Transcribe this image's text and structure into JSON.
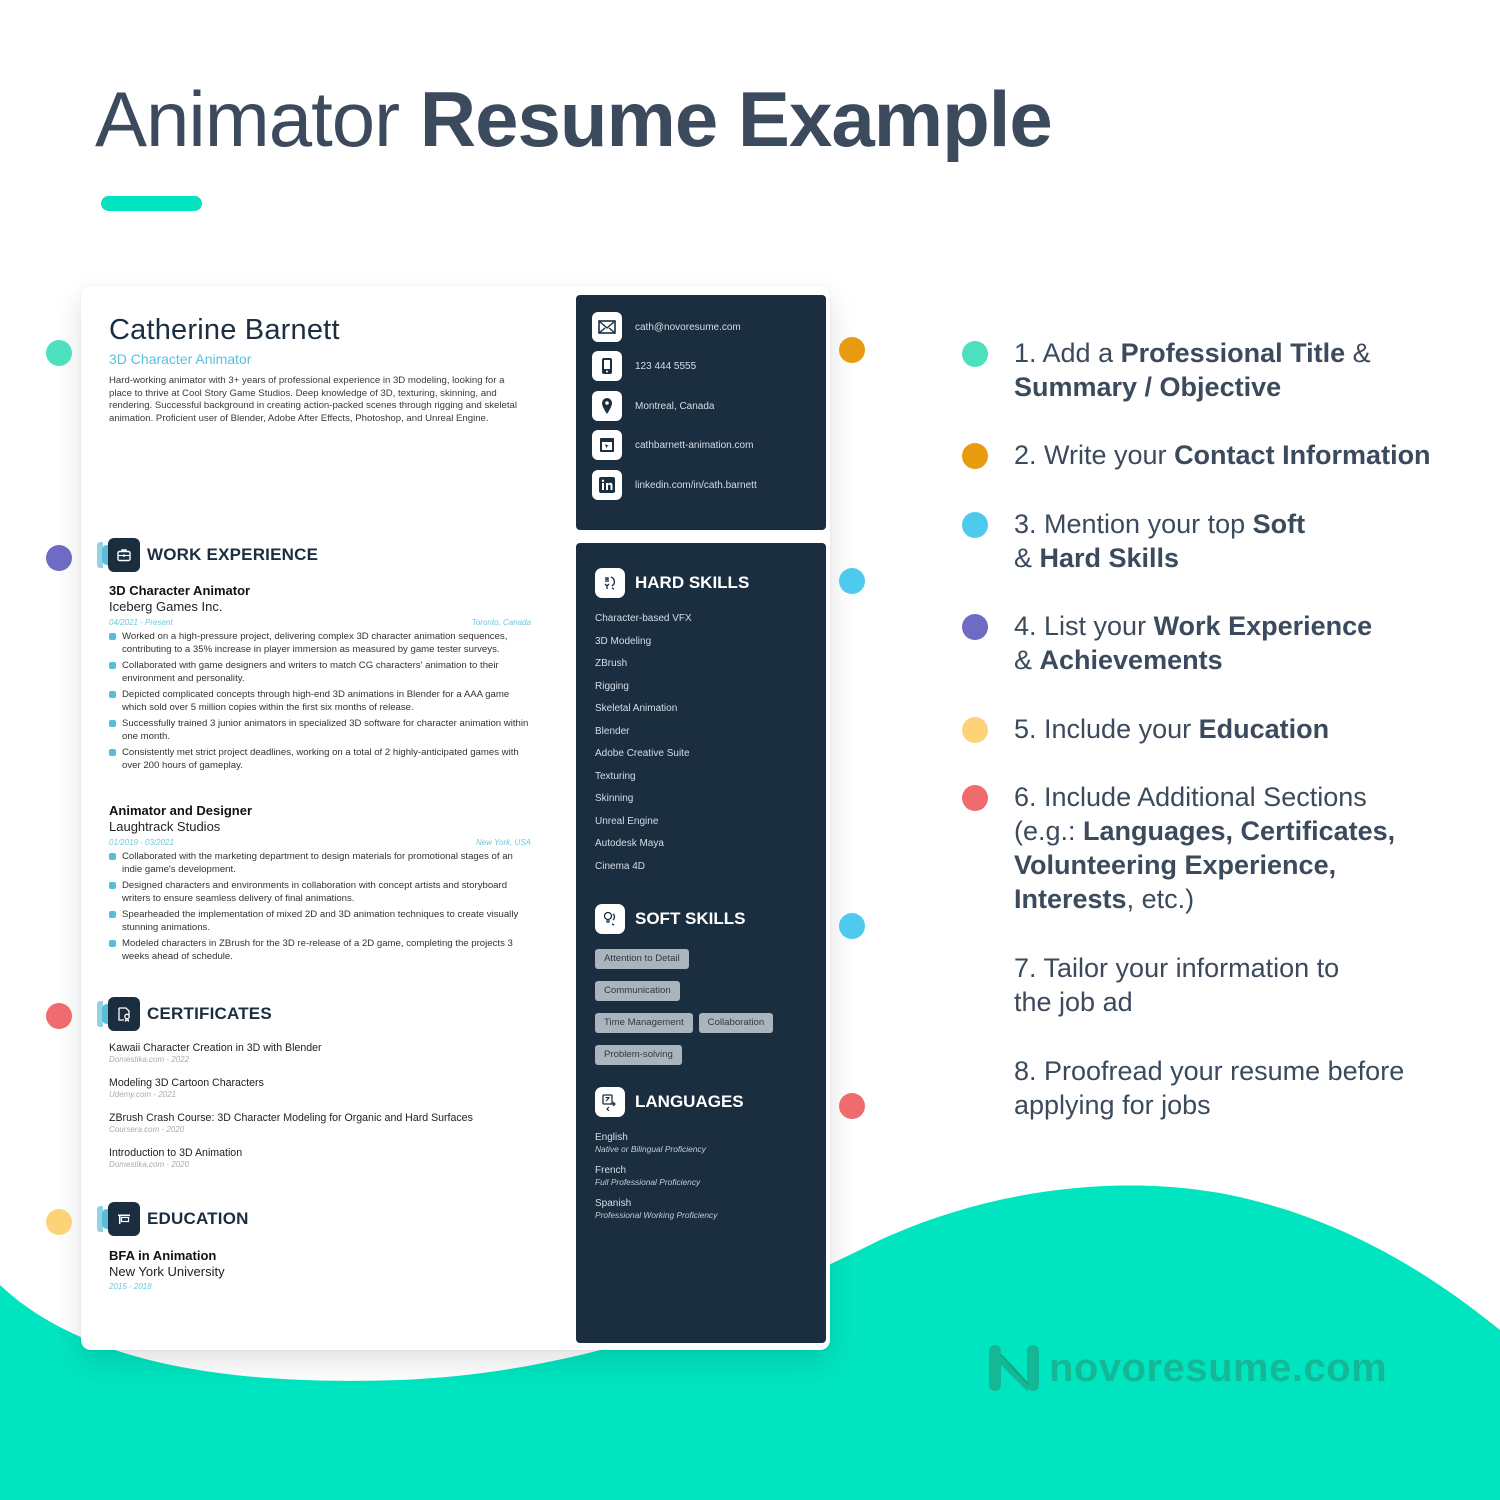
{
  "colors": {
    "accent": "#00e5c0",
    "navy": "#1b2e40",
    "skyblue": "#5bbcd6",
    "marker_teal": "#4de0bf",
    "marker_orange": "#e89b0f",
    "marker_cyan": "#4dcaee",
    "marker_purple": "#6e6bc5",
    "marker_yellow": "#fdd37a",
    "marker_red": "#ef6b6e"
  },
  "header": {
    "title_light": "Animator",
    "title_bold": "Resume Example"
  },
  "resume": {
    "name": "Catherine Barnett",
    "role": "3D Character Animator",
    "summary": "Hard-working animator with 3+ years of professional experience in 3D modeling, looking for a place to thrive at Cool Story Game Studios. Deep knowledge of 3D, texturing, skinning, and rendering. Successful background in creating action-packed scenes through rigging and skeletal animation. Proficient user of Blender, Adobe After Effects, Photoshop, and Unreal Engine.",
    "contact": [
      {
        "icon": "email-icon",
        "text": "cath@novoresume.com"
      },
      {
        "icon": "phone-icon",
        "text": "123 444 5555"
      },
      {
        "icon": "location-icon",
        "text": "Montreal, Canada"
      },
      {
        "icon": "website-icon",
        "text": "cathbarnett-animation.com"
      },
      {
        "icon": "linkedin-icon",
        "text": "linkedin.com/in/cath.barnett"
      }
    ],
    "work_experience": {
      "title": "WORK EXPERIENCE",
      "icon": "briefcase-icon",
      "jobs": [
        {
          "title": "3D Character Animator",
          "company": "Iceberg Games Inc.",
          "dates": "04/2021 - Present",
          "location": "Toronto, Canada",
          "bullets": [
            "Worked on a high-pressure project, delivering complex 3D character animation sequences, contributing to a 35% increase in player immersion as measured by game tester surveys.",
            "Collaborated with game designers and writers to match CG characters' animation to their environment and personality.",
            "Depicted complicated concepts through high-end 3D animations in Blender for a AAA game which sold over 5 million copies within the first six months of release.",
            "Successfully trained 3 junior animators in specialized 3D software for character animation within one month.",
            "Consistently met strict project deadlines, working on a total of 2 highly-anticipated games with over 200 hours of gameplay."
          ]
        },
        {
          "title": "Animator and Designer",
          "company": "Laughtrack Studios",
          "dates": "01/2019 - 03/2021",
          "location": "New York, USA",
          "bullets": [
            "Collaborated with the marketing department to design materials for promotional stages of an indie game's development.",
            "Designed characters and environments in collaboration with concept artists and storyboard writers to ensure seamless delivery of final animations.",
            "Spearheaded the implementation of mixed 2D and 3D animation techniques to create visually stunning animations.",
            "Modeled characters in ZBrush for the 3D re-release of a 2D game, completing the projects 3 weeks ahead of schedule."
          ]
        }
      ]
    },
    "certificates": {
      "title": "CERTIFICATES",
      "icon": "certificate-icon",
      "items": [
        {
          "name": "Kawaii Character Creation in 3D with Blender",
          "source": "Domestika.com - 2022"
        },
        {
          "name": "Modeling 3D Cartoon Characters",
          "source": "Udemy.com - 2021"
        },
        {
          "name": "ZBrush Crash Course: 3D Character Modeling for Organic and Hard Surfaces",
          "source": "Coursera.com - 2020"
        },
        {
          "name": "Introduction to 3D Animation",
          "source": "Domestika.com - 2020"
        }
      ]
    },
    "education": {
      "title": "EDUCATION",
      "icon": "graduation-icon",
      "degree": "BFA in Animation",
      "school": "New York University",
      "dates": "2015 - 2018"
    },
    "hard_skills": {
      "title": "HARD SKILLS",
      "icon": "hard-skills-icon",
      "items": [
        "Character-based VFX",
        "3D Modeling",
        "ZBrush",
        "Rigging",
        "Skeletal Animation",
        "Blender",
        "Adobe Creative Suite",
        "Texturing",
        "Skinning",
        "Unreal Engine",
        "Autodesk Maya",
        "Cinema 4D"
      ]
    },
    "soft_skills": {
      "title": "SOFT SKILLS",
      "icon": "soft-skills-icon",
      "items": [
        "Attention to Detail",
        "Communication",
        "Time Management",
        "Collaboration",
        "Problem-solving"
      ]
    },
    "languages": {
      "title": "LANGUAGES",
      "icon": "languages-icon",
      "items": [
        {
          "name": "English",
          "level": "Native or Bilingual Proficiency"
        },
        {
          "name": "French",
          "level": "Full Professional Proficiency"
        },
        {
          "name": "Spanish",
          "level": "Professional Working Proficiency"
        }
      ]
    }
  },
  "tips": [
    {
      "parts": [
        {
          "t": "1. Add a ",
          "b": false
        },
        {
          "t": "Professional Title",
          "b": true
        },
        {
          "t": " & ",
          "b": false
        },
        {
          "t": "Summary / Objective",
          "b": true
        }
      ]
    },
    {
      "parts": [
        {
          "t": "2. Write your ",
          "b": false
        },
        {
          "t": "Contact Information",
          "b": true
        }
      ]
    },
    {
      "parts": [
        {
          "t": "3. Mention your top ",
          "b": false
        },
        {
          "t": "Soft",
          "b": true
        },
        {
          "t": " & ",
          "b": false
        },
        {
          "t": "Hard Skills",
          "b": true
        }
      ]
    },
    {
      "parts": [
        {
          "t": "4. List your ",
          "b": false
        },
        {
          "t": "Work Experience",
          "b": true
        },
        {
          "t": " & ",
          "b": false
        },
        {
          "t": "Achievements",
          "b": true
        }
      ]
    },
    {
      "parts": [
        {
          "t": "5. Include your ",
          "b": false
        },
        {
          "t": "Education",
          "b": true
        }
      ]
    },
    {
      "parts": [
        {
          "t": "6. Include Additional Sections (e.g.: ",
          "b": false
        },
        {
          "t": "Languages, Certificates, Volunteering Experience, Interests",
          "b": true
        },
        {
          "t": ", etc.)",
          "b": false
        }
      ]
    },
    {
      "parts": [
        {
          "t": "7. Tailor your information to the job ad",
          "b": false
        }
      ]
    },
    {
      "parts": [
        {
          "t": "8. Proofread your resume before applying for jobs",
          "b": false
        }
      ]
    }
  ],
  "brand": {
    "name": "novoresume.com"
  }
}
